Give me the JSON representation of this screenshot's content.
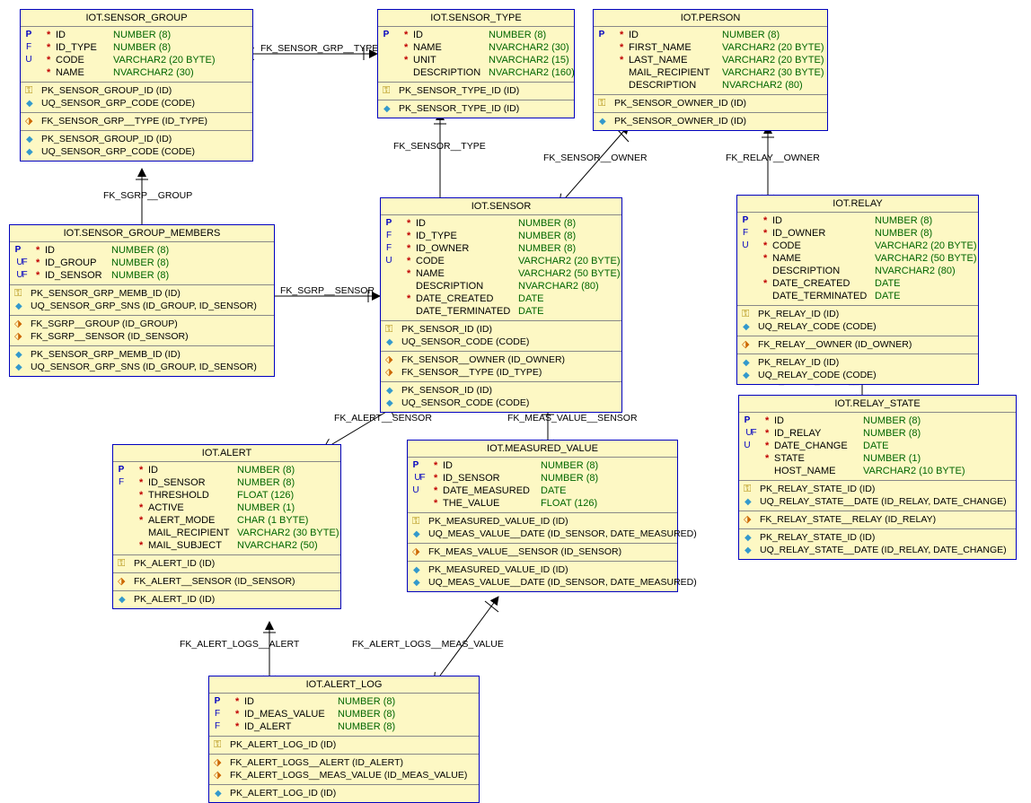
{
  "entities": {
    "sensor_group": {
      "title": "IOT.SENSOR_GROUP",
      "columns": [
        {
          "flags": "P",
          "mand": "*",
          "name": "ID",
          "type": "NUMBER (8)"
        },
        {
          "flags": "F",
          "mand": "*",
          "name": "ID_TYPE",
          "type": "NUMBER (8)"
        },
        {
          "flags": "U",
          "mand": "*",
          "name": "CODE",
          "type": "VARCHAR2 (20 BYTE)"
        },
        {
          "flags": "",
          "mand": "*",
          "name": "NAME",
          "type": "NVARCHAR2 (30)"
        }
      ],
      "sec1": [
        {
          "icon": "key",
          "text": "PK_SENSOR_GROUP_ID (ID)"
        },
        {
          "icon": "diamond",
          "text": "UQ_SENSOR_GRP_CODE (CODE)"
        }
      ],
      "sec2": [
        {
          "icon": "fk",
          "text": "FK_SENSOR_GRP__TYPE (ID_TYPE)"
        }
      ],
      "sec3": [
        {
          "icon": "diamond",
          "text": "PK_SENSOR_GROUP_ID (ID)"
        },
        {
          "icon": "diamond",
          "text": "UQ_SENSOR_GRP_CODE (CODE)"
        }
      ]
    },
    "sensor_type": {
      "title": "IOT.SENSOR_TYPE",
      "columns": [
        {
          "flags": "P",
          "mand": "*",
          "name": "ID",
          "type": "NUMBER (8)"
        },
        {
          "flags": "",
          "mand": "*",
          "name": "NAME",
          "type": "NVARCHAR2 (30)"
        },
        {
          "flags": "",
          "mand": "*",
          "name": "UNIT",
          "type": "NVARCHAR2 (15)"
        },
        {
          "flags": "",
          "mand": "",
          "name": "DESCRIPTION",
          "type": "NVARCHAR2 (160)"
        }
      ],
      "sec1": [
        {
          "icon": "key",
          "text": "PK_SENSOR_TYPE_ID (ID)"
        }
      ],
      "sec2": [
        {
          "icon": "diamond",
          "text": "PK_SENSOR_TYPE_ID (ID)"
        }
      ]
    },
    "person": {
      "title": "IOT.PERSON",
      "columns": [
        {
          "flags": "P",
          "mand": "*",
          "name": "ID",
          "type": "NUMBER (8)"
        },
        {
          "flags": "",
          "mand": "*",
          "name": "FIRST_NAME",
          "type": "VARCHAR2 (20 BYTE)"
        },
        {
          "flags": "",
          "mand": "*",
          "name": "LAST_NAME",
          "type": "VARCHAR2 (20 BYTE)"
        },
        {
          "flags": "",
          "mand": "",
          "name": "MAIL_RECIPIENT",
          "type": "VARCHAR2 (30 BYTE)"
        },
        {
          "flags": "",
          "mand": "",
          "name": "DESCRIPTION",
          "type": "NVARCHAR2 (80)"
        }
      ],
      "sec1": [
        {
          "icon": "key",
          "text": "PK_SENSOR_OWNER_ID (ID)"
        }
      ],
      "sec2": [
        {
          "icon": "diamond",
          "text": "PK_SENSOR_OWNER_ID (ID)"
        }
      ]
    },
    "sensor_group_members": {
      "title": "IOT.SENSOR_GROUP_MEMBERS",
      "columns": [
        {
          "flags": "P",
          "mand": "*",
          "name": "ID",
          "type": "NUMBER (8)"
        },
        {
          "flags": "UF",
          "mand": "*",
          "name": "ID_GROUP",
          "type": "NUMBER (8)"
        },
        {
          "flags": "UF",
          "mand": "*",
          "name": "ID_SENSOR",
          "type": "NUMBER (8)"
        }
      ],
      "sec1": [
        {
          "icon": "key",
          "text": "PK_SENSOR_GRP_MEMB_ID (ID)"
        },
        {
          "icon": "diamond",
          "text": "UQ_SENSOR_GRP_SNS (ID_GROUP, ID_SENSOR)"
        }
      ],
      "sec2": [
        {
          "icon": "fk",
          "text": "FK_SGRP__GROUP (ID_GROUP)"
        },
        {
          "icon": "fk",
          "text": "FK_SGRP__SENSOR (ID_SENSOR)"
        }
      ],
      "sec3": [
        {
          "icon": "diamond",
          "text": "PK_SENSOR_GRP_MEMB_ID (ID)"
        },
        {
          "icon": "diamond",
          "text": "UQ_SENSOR_GRP_SNS (ID_GROUP, ID_SENSOR)"
        }
      ]
    },
    "sensor": {
      "title": "IOT.SENSOR",
      "columns": [
        {
          "flags": "P",
          "mand": "*",
          "name": "ID",
          "type": "NUMBER (8)"
        },
        {
          "flags": "F",
          "mand": "*",
          "name": "ID_TYPE",
          "type": "NUMBER (8)"
        },
        {
          "flags": "F",
          "mand": "*",
          "name": "ID_OWNER",
          "type": "NUMBER (8)"
        },
        {
          "flags": "U",
          "mand": "*",
          "name": "CODE",
          "type": "VARCHAR2 (20 BYTE)"
        },
        {
          "flags": "",
          "mand": "*",
          "name": "NAME",
          "type": "VARCHAR2 (50 BYTE)"
        },
        {
          "flags": "",
          "mand": "",
          "name": "DESCRIPTION",
          "type": "NVARCHAR2 (80)"
        },
        {
          "flags": "",
          "mand": "*",
          "name": "DATE_CREATED",
          "type": "DATE"
        },
        {
          "flags": "",
          "mand": "",
          "name": "DATE_TERMINATED",
          "type": "DATE"
        }
      ],
      "sec1": [
        {
          "icon": "key",
          "text": "PK_SENSOR_ID (ID)"
        },
        {
          "icon": "diamond",
          "text": "UQ_SENSOR_CODE (CODE)"
        }
      ],
      "sec2": [
        {
          "icon": "fk",
          "text": "FK_SENSOR__OWNER (ID_OWNER)"
        },
        {
          "icon": "fk",
          "text": "FK_SENSOR__TYPE (ID_TYPE)"
        }
      ],
      "sec3": [
        {
          "icon": "diamond",
          "text": "PK_SENSOR_ID (ID)"
        },
        {
          "icon": "diamond",
          "text": "UQ_SENSOR_CODE (CODE)"
        }
      ]
    },
    "relay": {
      "title": "IOT.RELAY",
      "columns": [
        {
          "flags": "P",
          "mand": "*",
          "name": "ID",
          "type": "NUMBER (8)"
        },
        {
          "flags": "F",
          "mand": "*",
          "name": "ID_OWNER",
          "type": "NUMBER (8)"
        },
        {
          "flags": "U",
          "mand": "*",
          "name": "CODE",
          "type": "VARCHAR2 (20 BYTE)"
        },
        {
          "flags": "",
          "mand": "*",
          "name": "NAME",
          "type": "VARCHAR2 (50 BYTE)"
        },
        {
          "flags": "",
          "mand": "",
          "name": "DESCRIPTION",
          "type": "NVARCHAR2 (80)"
        },
        {
          "flags": "",
          "mand": "*",
          "name": "DATE_CREATED",
          "type": "DATE"
        },
        {
          "flags": "",
          "mand": "",
          "name": "DATE_TERMINATED",
          "type": "DATE"
        }
      ],
      "sec1": [
        {
          "icon": "key",
          "text": "PK_RELAY_ID (ID)"
        },
        {
          "icon": "diamond",
          "text": "UQ_RELAY_CODE (CODE)"
        }
      ],
      "sec2": [
        {
          "icon": "fk",
          "text": "FK_RELAY__OWNER (ID_OWNER)"
        }
      ],
      "sec3": [
        {
          "icon": "diamond",
          "text": "PK_RELAY_ID (ID)"
        },
        {
          "icon": "diamond",
          "text": "UQ_RELAY_CODE (CODE)"
        }
      ]
    },
    "alert": {
      "title": "IOT.ALERT",
      "columns": [
        {
          "flags": "P",
          "mand": "*",
          "name": "ID",
          "type": "NUMBER (8)"
        },
        {
          "flags": "F",
          "mand": "*",
          "name": "ID_SENSOR",
          "type": "NUMBER (8)"
        },
        {
          "flags": "",
          "mand": "*",
          "name": "THRESHOLD",
          "type": "FLOAT (126)"
        },
        {
          "flags": "",
          "mand": "*",
          "name": "ACTIVE",
          "type": "NUMBER (1)"
        },
        {
          "flags": "",
          "mand": "*",
          "name": "ALERT_MODE",
          "type": "CHAR (1 BYTE)"
        },
        {
          "flags": "",
          "mand": "",
          "name": "MAIL_RECIPIENT",
          "type": "VARCHAR2 (30 BYTE)"
        },
        {
          "flags": "",
          "mand": "*",
          "name": "MAIL_SUBJECT",
          "type": "NVARCHAR2 (50)"
        }
      ],
      "sec1": [
        {
          "icon": "key",
          "text": "PK_ALERT_ID (ID)"
        }
      ],
      "sec2": [
        {
          "icon": "fk",
          "text": "FK_ALERT__SENSOR (ID_SENSOR)"
        }
      ],
      "sec3": [
        {
          "icon": "diamond",
          "text": "PK_ALERT_ID (ID)"
        }
      ]
    },
    "measured_value": {
      "title": "IOT.MEASURED_VALUE",
      "columns": [
        {
          "flags": "P",
          "mand": "*",
          "name": "ID",
          "type": "NUMBER (8)"
        },
        {
          "flags": "UF",
          "mand": "*",
          "name": "ID_SENSOR",
          "type": "NUMBER (8)"
        },
        {
          "flags": "U",
          "mand": "*",
          "name": "DATE_MEASURED",
          "type": "DATE"
        },
        {
          "flags": "",
          "mand": "*",
          "name": "THE_VALUE",
          "type": "FLOAT (126)"
        }
      ],
      "sec1": [
        {
          "icon": "key",
          "text": "PK_MEASURED_VALUE_ID (ID)"
        },
        {
          "icon": "diamond",
          "text": "UQ_MEAS_VALUE__DATE (ID_SENSOR, DATE_MEASURED)"
        }
      ],
      "sec2": [
        {
          "icon": "fk",
          "text": "FK_MEAS_VALUE__SENSOR (ID_SENSOR)"
        }
      ],
      "sec3": [
        {
          "icon": "diamond",
          "text": "PK_MEASURED_VALUE_ID (ID)"
        },
        {
          "icon": "diamond",
          "text": "UQ_MEAS_VALUE__DATE (ID_SENSOR, DATE_MEASURED)"
        }
      ]
    },
    "relay_state": {
      "title": "IOT.RELAY_STATE",
      "columns": [
        {
          "flags": "P",
          "mand": "*",
          "name": "ID",
          "type": "NUMBER (8)"
        },
        {
          "flags": "UF",
          "mand": "*",
          "name": "ID_RELAY",
          "type": "NUMBER (8)"
        },
        {
          "flags": "U",
          "mand": "*",
          "name": "DATE_CHANGE",
          "type": "DATE"
        },
        {
          "flags": "",
          "mand": "*",
          "name": "STATE",
          "type": "NUMBER (1)"
        },
        {
          "flags": "",
          "mand": "",
          "name": "HOST_NAME",
          "type": "VARCHAR2 (10 BYTE)"
        }
      ],
      "sec1": [
        {
          "icon": "key",
          "text": "PK_RELAY_STATE_ID (ID)"
        },
        {
          "icon": "diamond",
          "text": "UQ_RELAY_STATE__DATE (ID_RELAY, DATE_CHANGE)"
        }
      ],
      "sec2": [
        {
          "icon": "fk",
          "text": "FK_RELAY_STATE__RELAY (ID_RELAY)"
        }
      ],
      "sec3": [
        {
          "icon": "diamond",
          "text": "PK_RELAY_STATE_ID (ID)"
        },
        {
          "icon": "diamond",
          "text": "UQ_RELAY_STATE__DATE (ID_RELAY, DATE_CHANGE)"
        }
      ]
    },
    "alert_log": {
      "title": "IOT.ALERT_LOG",
      "columns": [
        {
          "flags": "P",
          "mand": "*",
          "name": "ID",
          "type": "NUMBER (8)"
        },
        {
          "flags": "F",
          "mand": "*",
          "name": "ID_MEAS_VALUE",
          "type": "NUMBER (8)"
        },
        {
          "flags": "F",
          "mand": "*",
          "name": "ID_ALERT",
          "type": "NUMBER (8)"
        }
      ],
      "sec1": [
        {
          "icon": "key",
          "text": "PK_ALERT_LOG_ID (ID)"
        }
      ],
      "sec2": [
        {
          "icon": "fk",
          "text": "FK_ALERT_LOGS__ALERT (ID_ALERT)"
        },
        {
          "icon": "fk",
          "text": "FK_ALERT_LOGS__MEAS_VALUE (ID_MEAS_VALUE)"
        }
      ],
      "sec3": [
        {
          "icon": "diamond",
          "text": "PK_ALERT_LOG_ID (ID)"
        }
      ]
    }
  },
  "relations": {
    "r1": "FK_SENSOR_GRP__TYPE",
    "r2": "FK_SENSOR__TYPE",
    "r3": "FK_SENSOR__OWNER",
    "r4": "FK_RELAY__OWNER",
    "r5": "FK_SGRP__GROUP",
    "r6": "FK_SGRP__SENSOR",
    "r7": "FK_ALERT__SENSOR",
    "r8": "FK_MEAS_VALUE__SENSOR",
    "r9": "FK_RELAY_STATE__RELAY",
    "r10": "FK_ALERT_LOGS__ALERT",
    "r11": "FK_ALERT_LOGS__MEAS_VALUE"
  }
}
